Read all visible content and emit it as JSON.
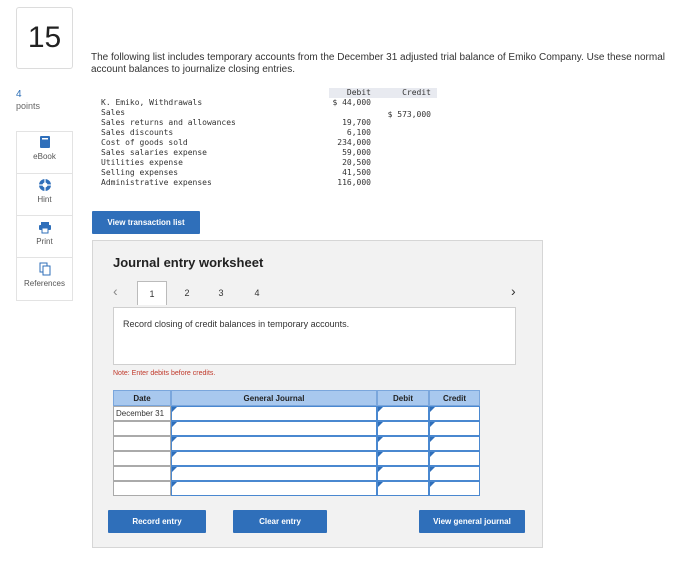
{
  "question": {
    "number": "15",
    "points_value": "4",
    "points_label": "points"
  },
  "tools": [
    {
      "label": "eBook",
      "icon": "book-icon"
    },
    {
      "label": "Hint",
      "icon": "lifebuoy-icon"
    },
    {
      "label": "Print",
      "icon": "printer-icon"
    },
    {
      "label": "References",
      "icon": "documents-icon"
    }
  ],
  "prompt": "The following list includes temporary accounts from the December 31 adjusted trial balance of Emiko Company. Use these normal account balances to journalize closing entries.",
  "trial_balance": {
    "headers": {
      "debit": "Debit",
      "credit": "Credit"
    },
    "rows": [
      {
        "name": "K. Emiko, Withdrawals",
        "debit": "$ 44,000",
        "credit": ""
      },
      {
        "name": "Sales",
        "debit": "",
        "credit": "$ 573,000"
      },
      {
        "name": "Sales returns and allowances",
        "debit": "19,700",
        "credit": ""
      },
      {
        "name": "Sales discounts",
        "debit": "6,100",
        "credit": ""
      },
      {
        "name": "Cost of goods sold",
        "debit": "234,000",
        "credit": ""
      },
      {
        "name": "Sales salaries expense",
        "debit": "59,000",
        "credit": ""
      },
      {
        "name": "Utilities expense",
        "debit": "20,500",
        "credit": ""
      },
      {
        "name": "Selling expenses",
        "debit": "41,500",
        "credit": ""
      },
      {
        "name": "Administrative expenses",
        "debit": "116,000",
        "credit": ""
      }
    ]
  },
  "view_transaction_button": "View transaction list",
  "worksheet": {
    "title": "Journal entry worksheet",
    "tabs": [
      "1",
      "2",
      "3",
      "4"
    ],
    "active_tab": "1",
    "instruction": "Record closing of credit balances in temporary accounts.",
    "note": "Note: Enter debits before credits.",
    "columns": {
      "date": "Date",
      "journal": "General Journal",
      "debit": "Debit",
      "credit": "Credit"
    },
    "rows": [
      {
        "date": "December 31",
        "journal": "",
        "debit": "",
        "credit": ""
      },
      {
        "date": "",
        "journal": "",
        "debit": "",
        "credit": ""
      },
      {
        "date": "",
        "journal": "",
        "debit": "",
        "credit": ""
      },
      {
        "date": "",
        "journal": "",
        "debit": "",
        "credit": ""
      },
      {
        "date": "",
        "journal": "",
        "debit": "",
        "credit": ""
      },
      {
        "date": "",
        "journal": "",
        "debit": "",
        "credit": ""
      }
    ],
    "buttons": {
      "record": "Record entry",
      "clear": "Clear entry",
      "view_general": "View general journal"
    }
  },
  "colors": {
    "accent": "#2f6fba",
    "header_fill": "#a8c8ee",
    "note": "#c0392b"
  }
}
